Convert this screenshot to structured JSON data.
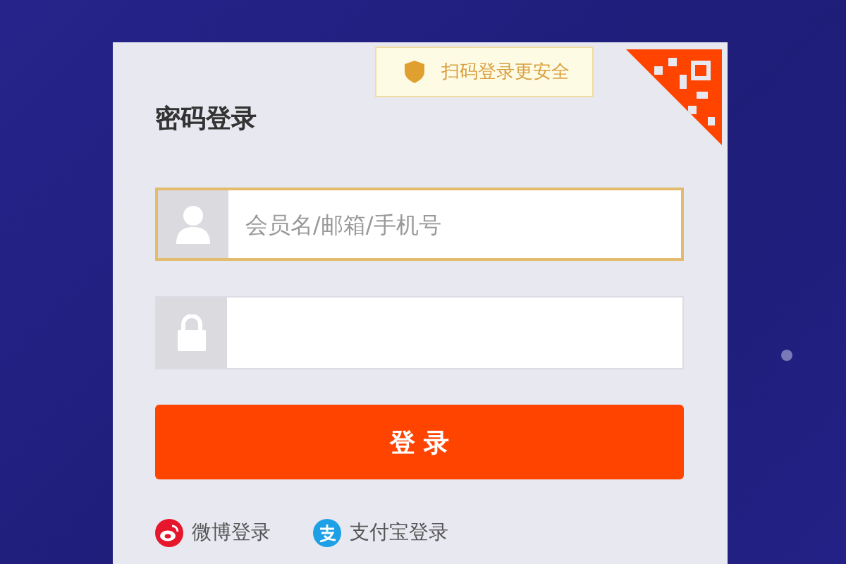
{
  "qr_tip": {
    "label": "扫码登录更安全"
  },
  "title": "密码登录",
  "fields": [
    {
      "kind": "user",
      "placeholder": "会员名/邮箱/手机号",
      "focused": true
    },
    {
      "kind": "lock",
      "focused": false
    }
  ],
  "submit": {
    "label": "登 录"
  },
  "social": [
    {
      "kind": "weibo",
      "label": "微博登录"
    },
    {
      "kind": "alipay",
      "label": "支付宝登录"
    }
  ]
}
